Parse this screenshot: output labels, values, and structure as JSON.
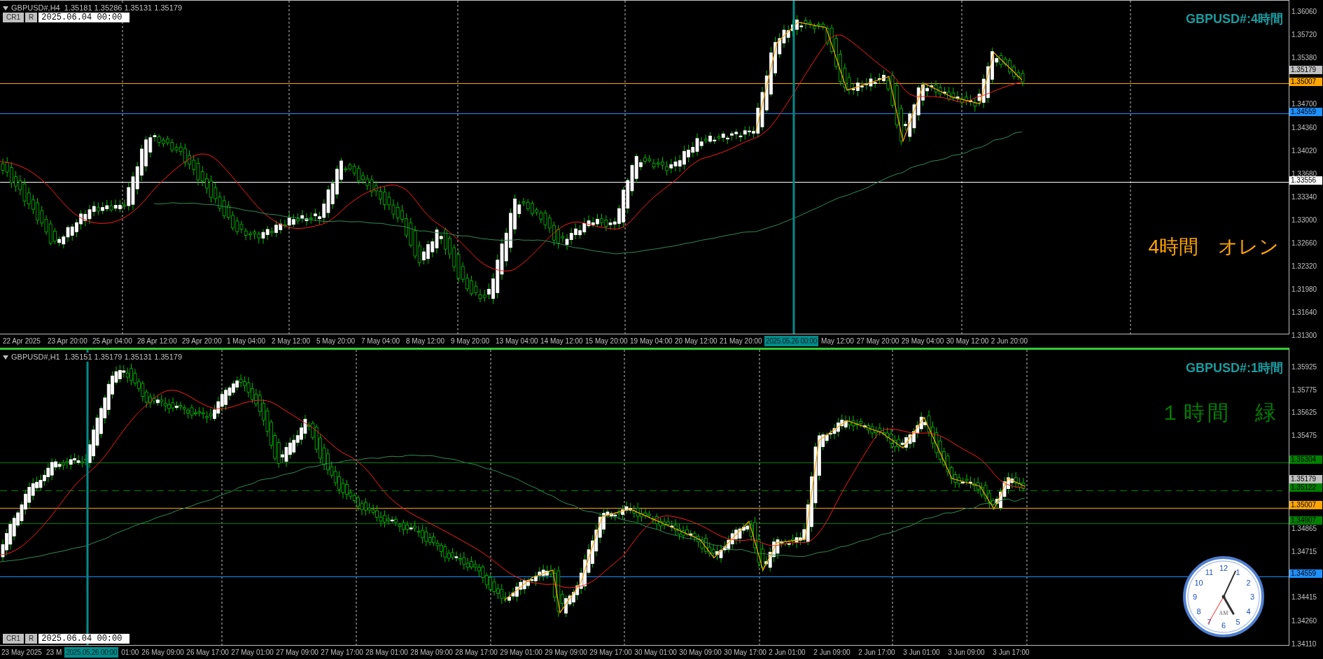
{
  "charts": [
    {
      "selected": false,
      "header": "GBPUSD#,H4  1.35181 1.35286 1.35131 1.35179",
      "buttons": [
        "CR1",
        "R"
      ],
      "date_field": "2025.06.04 00:00",
      "title": "GBPUSD#:4時間",
      "note": {
        "text": "4時間　オレン",
        "color": "#ffa500"
      },
      "price_labels": [
        "1.36060",
        "1.35720",
        "1.35380",
        "1.34700",
        "1.34360",
        "1.34020",
        "1.33680",
        "1.33340",
        "1.33000",
        "1.32660",
        "1.32320",
        "1.31980",
        "1.31640",
        "1.31300"
      ],
      "price_badges": [
        {
          "text": "1.35179",
          "color": "#c0c0c0",
          "kind": "price"
        },
        {
          "text": "1.35007",
          "color": "#ffa500",
          "kind": "line"
        },
        {
          "text": "1.34559",
          "color": "#1e90ff",
          "kind": "line"
        },
        {
          "text": "1.33556",
          "color": "#ffffff",
          "kind": "line"
        }
      ],
      "time_labels": [
        {
          "text": "22 Apr 2025",
          "kind": "tick"
        },
        {
          "text": "23 Apr 20:00",
          "kind": "tick"
        },
        {
          "text": "25 Apr 04:00",
          "kind": "tick"
        },
        {
          "text": "28 Apr 12:00",
          "kind": "tick"
        },
        {
          "text": "29 Apr 20:00",
          "kind": "tick"
        },
        {
          "text": "1 May 04:00",
          "kind": "tick"
        },
        {
          "text": "2 May 12:00",
          "kind": "tick"
        },
        {
          "text": "5 May 20:00",
          "kind": "tick"
        },
        {
          "text": "7 May 04:00",
          "kind": "tick"
        },
        {
          "text": "8 May 12:00",
          "kind": "tick"
        },
        {
          "text": "9 May 20:00",
          "kind": "tick"
        },
        {
          "text": "13 May 04:00",
          "kind": "tick"
        },
        {
          "text": "14 May 12:00",
          "kind": "tick"
        },
        {
          "text": "15 May 20:00",
          "kind": "tick"
        },
        {
          "text": "19 May 04:00",
          "kind": "tick"
        },
        {
          "text": "20 May 12:00",
          "kind": "tick"
        },
        {
          "text": "21 May 20:00",
          "kind": "tick"
        },
        {
          "text": "2025.05.26 00:00",
          "kind": "cursor"
        },
        {
          "text": "May 12:00",
          "kind": "cut"
        },
        {
          "text": "27 May 20:00",
          "kind": "tick"
        },
        {
          "text": "29 May 04:00",
          "kind": "tick"
        },
        {
          "text": "30 May 12:00",
          "kind": "tick"
        },
        {
          "text": "2 Jun 20:00",
          "kind": "tick"
        }
      ]
    },
    {
      "selected": true,
      "header": "GBPUSD#,H1  1.35151 1.35179 1.35131 1.35179",
      "buttons": [
        "CR1",
        "R"
      ],
      "date_field": "2025.06.04 00:00",
      "title": "GBPUSD#:1時間",
      "note": {
        "text": "１時間　緑",
        "color": "#008000"
      },
      "price_labels": [
        "1.35925",
        "1.35775",
        "1.35625",
        "1.35475",
        "1.34865",
        "1.34715",
        "1.34415",
        "1.34260",
        "1.34110"
      ],
      "price_badges": [
        {
          "text": "1.35304",
          "color": "#008000",
          "kind": "line"
        },
        {
          "text": "1.35179",
          "color": "#c0c0c0",
          "kind": "price"
        },
        {
          "text": "1.35122",
          "color": "#008000",
          "kind": "dashed"
        },
        {
          "text": "1.35007",
          "color": "#ffa500",
          "kind": "line"
        },
        {
          "text": "1.34907",
          "color": "#008000",
          "kind": "line"
        },
        {
          "text": "1.34559",
          "color": "#1e90ff",
          "kind": "line"
        }
      ],
      "time_labels": [
        {
          "text": "23 May 2025",
          "kind": "tick"
        },
        {
          "text": "23 M",
          "kind": "cut"
        },
        {
          "text": "2025.05.26 00:00",
          "kind": "cursor"
        },
        {
          "text": "01:00",
          "kind": "cut"
        },
        {
          "text": "26 May 09:00",
          "kind": "tick"
        },
        {
          "text": "26 May 17:00",
          "kind": "tick"
        },
        {
          "text": "27 May 01:00",
          "kind": "tick"
        },
        {
          "text": "27 May 09:00",
          "kind": "tick"
        },
        {
          "text": "27 May 17:00",
          "kind": "tick"
        },
        {
          "text": "28 May 01:00",
          "kind": "tick"
        },
        {
          "text": "28 May 09:00",
          "kind": "tick"
        },
        {
          "text": "28 May 17:00",
          "kind": "tick"
        },
        {
          "text": "29 May 01:00",
          "kind": "tick"
        },
        {
          "text": "29 May 09:00",
          "kind": "tick"
        },
        {
          "text": "29 May 17:00",
          "kind": "tick"
        },
        {
          "text": "30 May 01:00",
          "kind": "tick"
        },
        {
          "text": "30 May 09:00",
          "kind": "tick"
        },
        {
          "text": "30 May 17:00",
          "kind": "tick"
        },
        {
          "text": "2 Jun 01:00",
          "kind": "tick"
        },
        {
          "text": "2 Jun 09:00",
          "kind": "tick"
        },
        {
          "text": "2 Jun 17:00",
          "kind": "tick"
        },
        {
          "text": "3 Jun 01:00",
          "kind": "tick"
        },
        {
          "text": "3 Jun 09:00",
          "kind": "tick"
        },
        {
          "text": "3 Jun 17:00",
          "kind": "tick"
        }
      ]
    }
  ],
  "clock": {
    "numerals": [
      "12",
      "1",
      "2",
      "3",
      "4",
      "5",
      "6",
      "7",
      "8",
      "9",
      "10",
      "11"
    ],
    "period": "AM"
  }
}
